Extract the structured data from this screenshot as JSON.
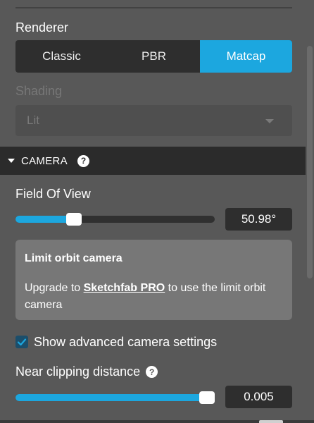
{
  "renderer": {
    "label": "Renderer",
    "options": [
      "Classic",
      "PBR",
      "Matcap"
    ],
    "selected": "Matcap"
  },
  "shading": {
    "label": "Shading",
    "value": "Lit"
  },
  "camera_section": {
    "title": "CAMERA",
    "help": "?"
  },
  "field_of_view": {
    "label": "Field Of View",
    "value": "50.98°",
    "slider_fraction": 0.29
  },
  "limit_orbit": {
    "title": "Limit orbit camera",
    "text_before": "Upgrade to ",
    "link": "Sketchfab PRO",
    "text_after": " to use the limit orbit camera"
  },
  "advanced": {
    "label": "Show advanced camera settings",
    "checked": true
  },
  "near_clipping": {
    "label": "Near clipping distance",
    "help": "?",
    "value": "0.005",
    "slider_fraction": 0.99
  },
  "colors": {
    "accent": "#1ca7df",
    "panel": "#585858",
    "dark": "#2e2e2e"
  }
}
